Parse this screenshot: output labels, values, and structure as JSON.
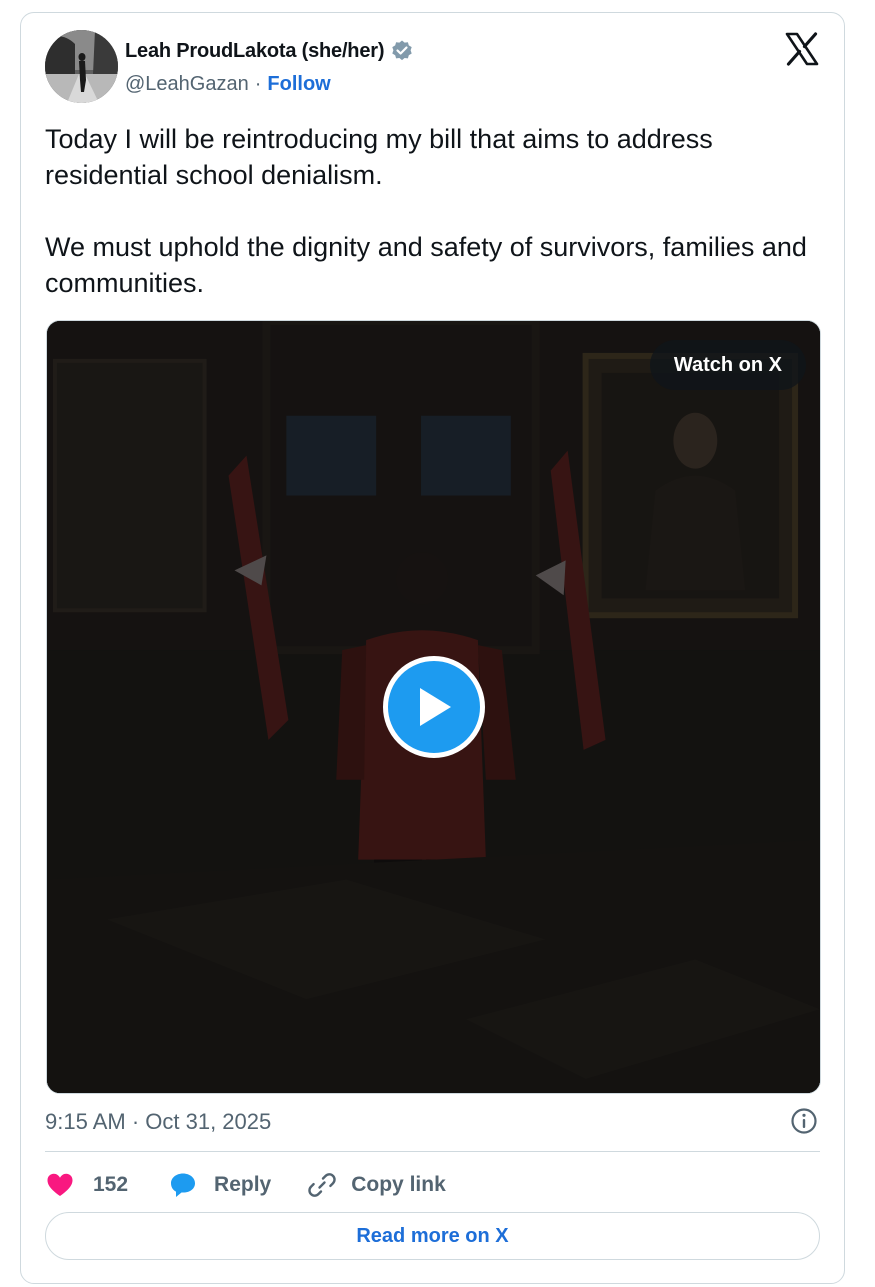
{
  "author": {
    "name": "Leah ProudLakota (she/her)",
    "handle": "@LeahGazan",
    "separator": "·",
    "follow_label": "Follow",
    "avatar_icon": "avatar",
    "verified_icon": "verified-badge-icon"
  },
  "tweet": {
    "paragraphs": [
      "Today I will be reintroducing my bill that aims to address residential school denialism.",
      "We must uphold the dignity and safety of survivors, families and communities."
    ]
  },
  "media": {
    "watch_label": "Watch on X",
    "play_icon": "play-icon"
  },
  "timestamp": "9:15 AM · Oct 31, 2025",
  "actions": {
    "like_count": "152",
    "reply_label": "Reply",
    "copy_label": "Copy link"
  },
  "read_more_label": "Read more on X",
  "colors": {
    "accent": "#1d6ed8",
    "like": "#f91880",
    "reply": "#1d9bf0",
    "muted": "#536471",
    "text": "#0f1419",
    "border": "#cfd9de"
  }
}
